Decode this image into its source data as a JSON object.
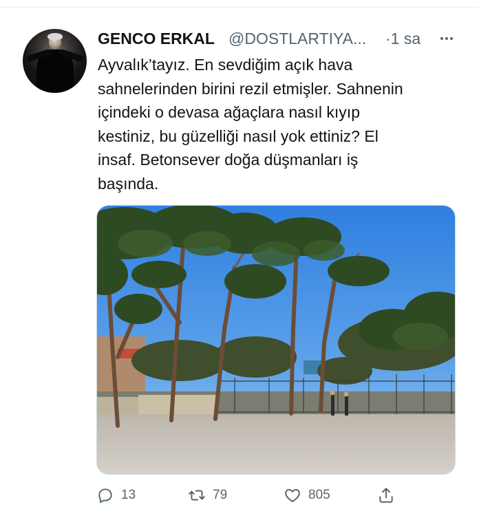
{
  "tweet": {
    "author": {
      "display_name": "GENCO ERKAL",
      "handle": "@DOSTLARTIYA...",
      "avatar_icon": "user-avatar"
    },
    "time_sep": "·",
    "time": "1 sa",
    "text": "Ayvalık’tayız. En sevdiğim açık hava\nsahnelerinden birini rezil etmişler. Sahnenin\niçindeki o devasa ağaçlara nasıl kıyıp\nkestiniz, bu güzelliği nasıl yok ettiniz? El\ninsaf. Betonsever doğa düşmanları iş\nbaşında.",
    "media": {
      "kind": "photo"
    },
    "actions": {
      "reply_count": "13",
      "retweet_count": "79",
      "like_count": "805"
    }
  },
  "colors": {
    "text_primary": "#0f1419",
    "text_secondary": "#536471",
    "divider": "#e6ecf0"
  }
}
